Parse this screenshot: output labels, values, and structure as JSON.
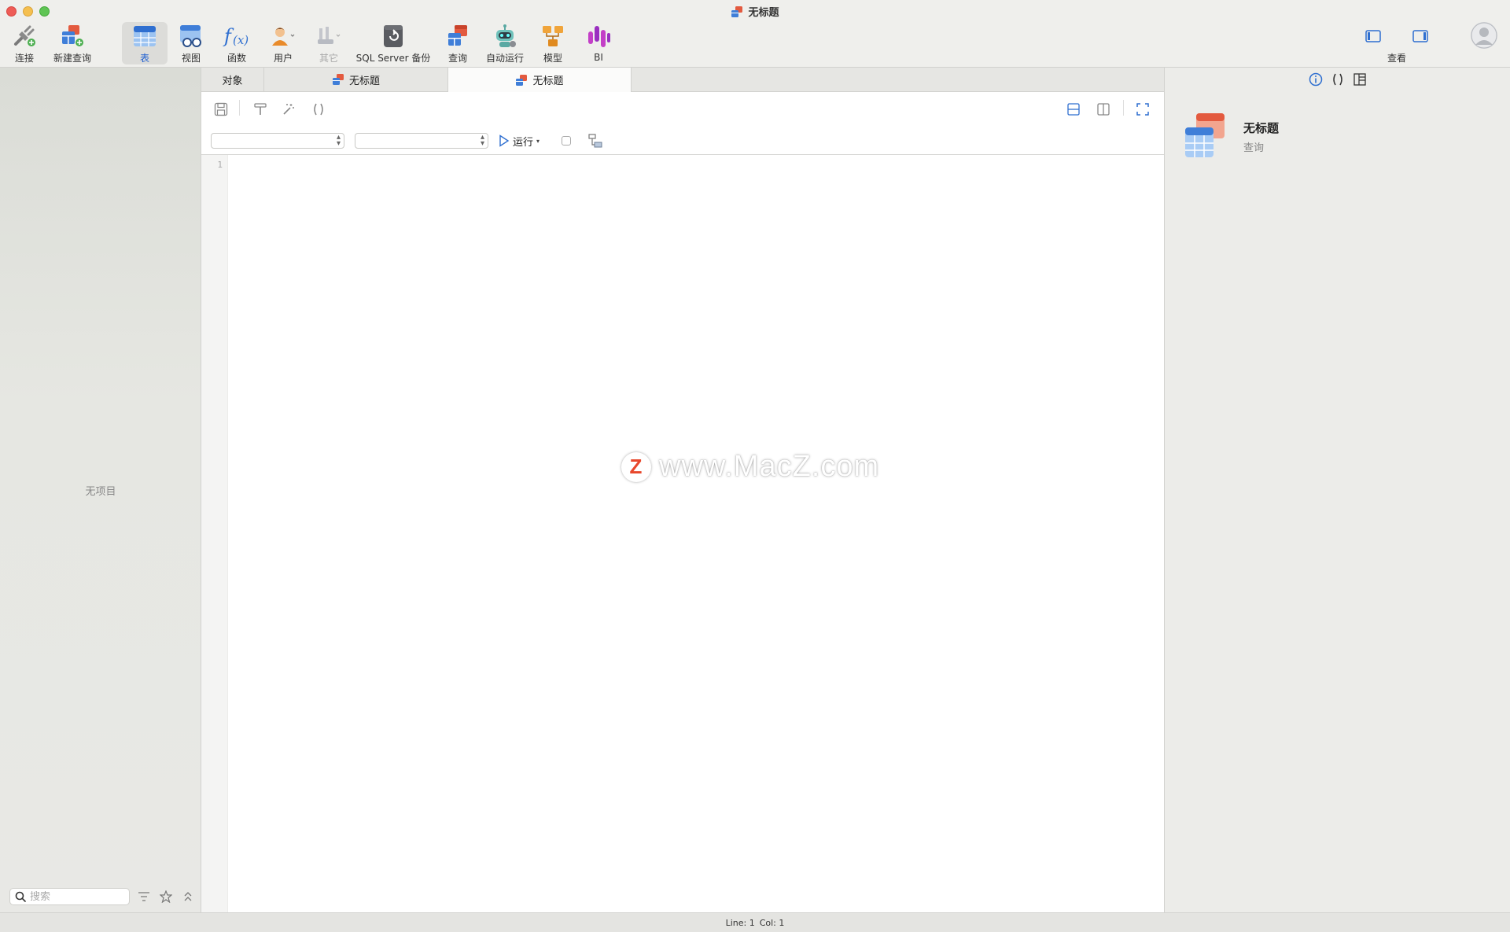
{
  "window": {
    "title": "无标题"
  },
  "toolbar": {
    "items": [
      {
        "label": "连接",
        "icon": "plug-icon"
      },
      {
        "label": "新建查询",
        "icon": "new-query-icon"
      },
      {
        "label": "表",
        "icon": "table-icon",
        "active": true
      },
      {
        "label": "视图",
        "icon": "view-icon"
      },
      {
        "label": "函数",
        "icon": "function-icon"
      },
      {
        "label": "用户",
        "icon": "user-icon"
      },
      {
        "label": "其它",
        "icon": "other-icon",
        "disabled": true
      },
      {
        "label": "SQL Server 备份",
        "icon": "backup-icon"
      },
      {
        "label": "查询",
        "icon": "query-icon"
      },
      {
        "label": "自动运行",
        "icon": "robot-icon"
      },
      {
        "label": "模型",
        "icon": "model-icon"
      },
      {
        "label": "BI",
        "icon": "bi-icon"
      }
    ],
    "view_label": "查看"
  },
  "sidebar": {
    "empty_text": "无项目",
    "search_placeholder": "搜索"
  },
  "tabs": [
    {
      "label": "对象"
    },
    {
      "label": "无标题"
    },
    {
      "label": "无标题",
      "active": true
    }
  ],
  "editor": {
    "run_label": "运行",
    "line_number": "1"
  },
  "watermark": {
    "logo_letter": "Z",
    "text": "www.MacZ.com"
  },
  "right_panel": {
    "object_name": "无标题",
    "object_type": "查询"
  },
  "status": {
    "line": "Line: 1",
    "col": "Col: 1"
  },
  "colors": {
    "accent": "#1f5fd1",
    "table_blue": "#3f7ed8",
    "table_red": "#e35a3f"
  }
}
